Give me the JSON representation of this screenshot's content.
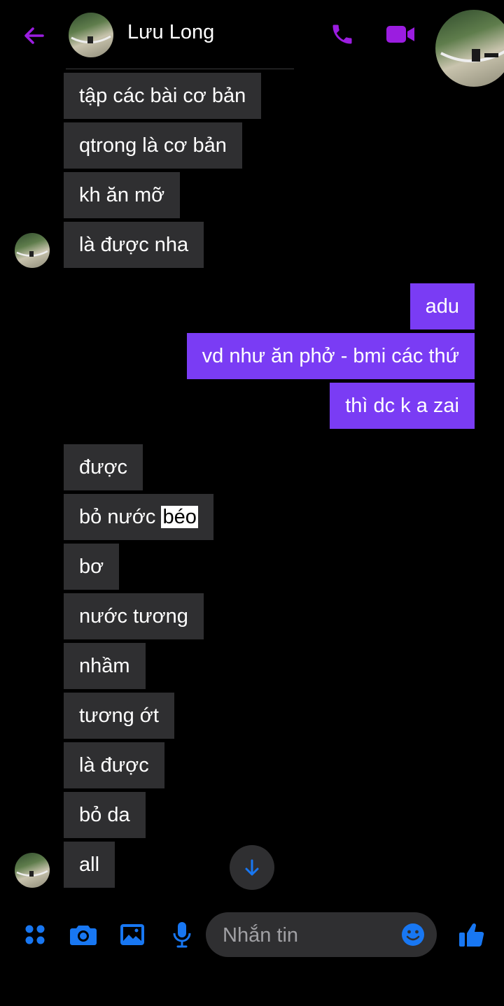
{
  "colors": {
    "accent": "#9b1de0",
    "outgoing": "#7a3cf4",
    "incoming": "#2f2f31",
    "toolbar": "#1877f2"
  },
  "header": {
    "back_icon": "arrow-left-icon",
    "contact_name": "Lưu Long",
    "call_icon": "phone-icon",
    "video_icon": "video-camera-icon"
  },
  "messages": {
    "g1": [
      "tập các bài cơ bản",
      "qtrong là cơ bản",
      "kh ăn mỡ",
      "là được nha"
    ],
    "g2": [
      "adu",
      "vd như ăn phở - bmi các thứ",
      "thì dc k a zai"
    ],
    "g3_m2_prefix": "bỏ nước ",
    "g3_m2_highlight": "béo",
    "g3": [
      "được",
      "bơ",
      "nước tương",
      "nhầm",
      "tương ớt",
      "là được",
      "bỏ da",
      "all"
    ]
  },
  "scroll_icon": "arrow-down-icon",
  "composer": {
    "placeholder": "Nhắn tin",
    "icons": [
      "grid-menu-icon",
      "camera-icon",
      "image-icon",
      "microphone-icon",
      "emoji-icon",
      "thumbs-up-icon"
    ]
  }
}
